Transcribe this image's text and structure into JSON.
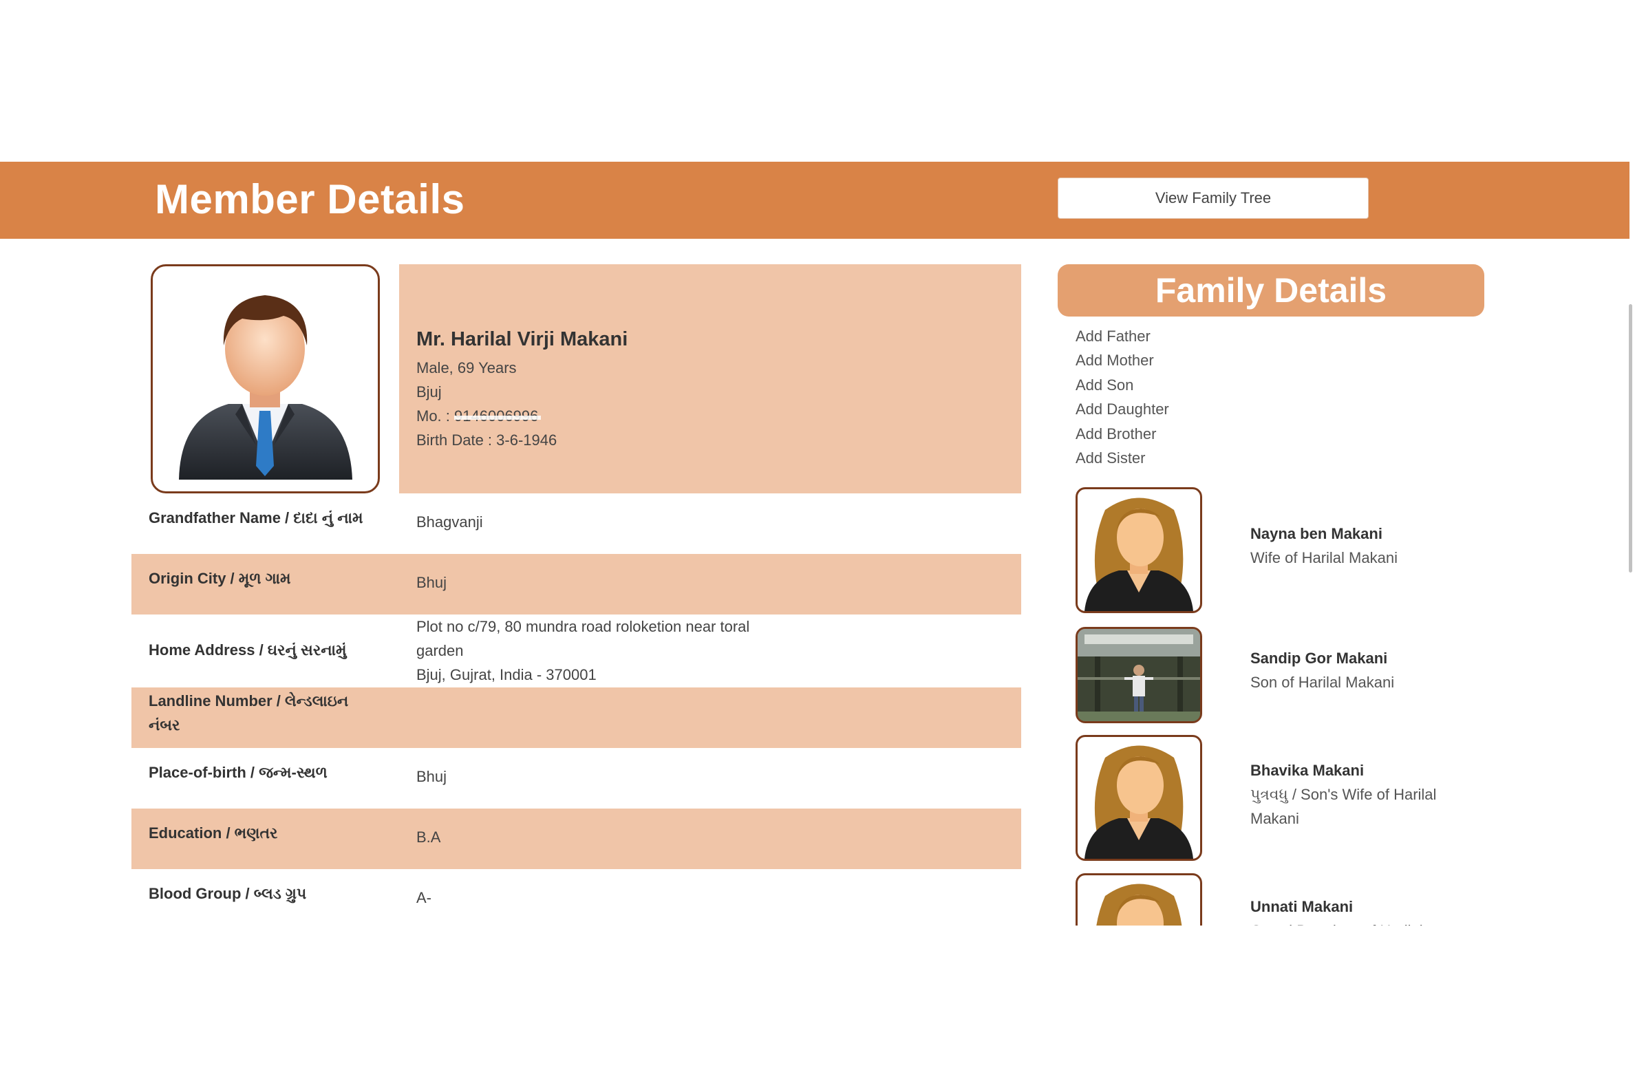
{
  "header": {
    "title": "Member Details",
    "view_tree_button": "View Family Tree"
  },
  "member": {
    "name": "Mr. Harilal Virji Makani",
    "gender_age": "Male, 69 Years",
    "city": "Bjuj",
    "mobile_label": "Mo. :",
    "mobile_value": "9146006996",
    "birth_date": "Birth Date : 3-6-1946"
  },
  "details": [
    {
      "label": "Grandfather Name / દાદા નું નામ",
      "value": "Bhagvanji"
    },
    {
      "label": "Origin City / મૂળ ગામ",
      "value": "Bhuj"
    },
    {
      "label": "Home Address / ઘરનું સરનામું",
      "value_lines": [
        "Plot no c/79, 80 mundra road roloketion near toral",
        "garden",
        "Bjuj, Gujrat, India - 370001"
      ]
    },
    {
      "label_lines": [
        "Landline Number / લેન્ડલાઇન",
        "નંબર"
      ],
      "value": ""
    },
    {
      "label": "Place-of-birth / જન્મ-સ્થળ",
      "value": "Bhuj"
    },
    {
      "label": "Education / ભણતર",
      "value": "B.A"
    },
    {
      "label": "Blood Group / બ્લડ ગ્રુપ",
      "value": "A-"
    }
  ],
  "family": {
    "title": "Family Details",
    "add_links": [
      "Add Father",
      "Add Mother",
      "Add Son",
      "Add Daughter",
      "Add Brother",
      "Add Sister"
    ],
    "members": [
      {
        "name": "Nayna ben Makani",
        "relation": "Wife of Harilal Makani",
        "photo": "female-avatar"
      },
      {
        "name": "Sandip Gor Makani",
        "relation": "Son of Harilal Makani",
        "photo": "photo-man-standing"
      },
      {
        "name": "Bhavika Makani",
        "relation": "પુત્રવધુ / Son's Wife of Harilal Makani",
        "photo": "female-avatar"
      },
      {
        "name": "Unnati Makani",
        "relation": "Grand Daughter of Harilal",
        "photo": "female-avatar"
      }
    ]
  },
  "colors": {
    "header_orange": "#d98347",
    "light_peach": "#f0c5a8",
    "family_header": "#e4a070",
    "photo_border": "#7a3b1c"
  }
}
